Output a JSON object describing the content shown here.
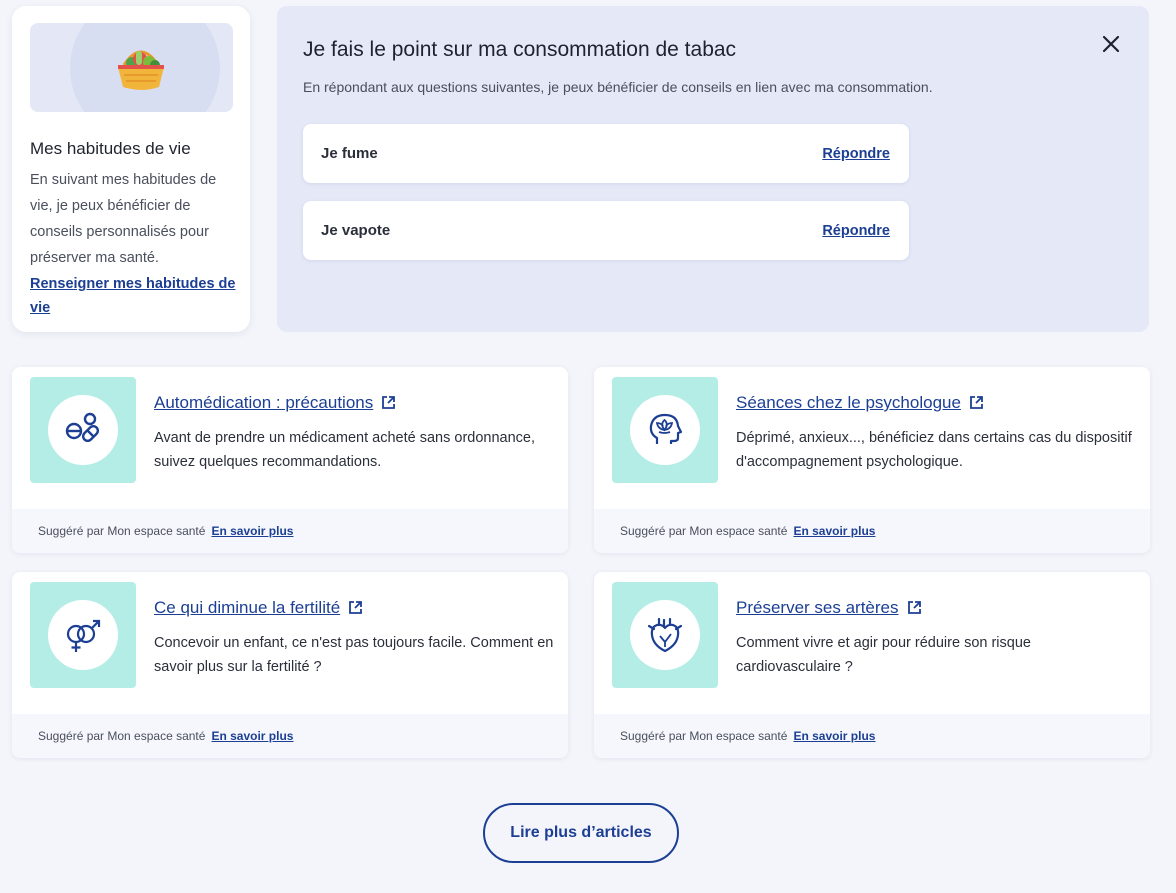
{
  "habits": {
    "illustration_icon": "basket-illustration",
    "title": "Mes habitudes de vie",
    "description": "En suivant mes habitudes de vie, je peux bénéficier de conseils personnalisés pour préserver ma santé.",
    "link": "Renseigner mes habitudes de vie"
  },
  "tabac": {
    "title": "Je fais le point sur ma consommation de tabac",
    "close_icon": "close-icon",
    "subtitle": "En répondant aux questions suivantes, je peux bénéficier de conseils en lien avec ma consommation.",
    "questions": [
      {
        "label": "Je fume",
        "action": "Répondre"
      },
      {
        "label": "Je vapote",
        "action": "Répondre"
      }
    ]
  },
  "articles": [
    {
      "icon": "pills-icon",
      "title": "Automédication : précautions",
      "description": "Avant de prendre un médicament acheté sans ordonnance, suivez quelques recommandations.",
      "footer_text": "Suggéré par Mon espace santé",
      "footer_link": "En savoir plus"
    },
    {
      "icon": "mind-icon",
      "title": "Séances chez le psychologue",
      "description": "Déprimé, anxieux..., bénéficiez dans certains cas du dispositif d'accompagnement psychologique.",
      "footer_text": "Suggéré par Mon espace santé",
      "footer_link": "En savoir plus"
    },
    {
      "icon": "gender-icon",
      "title": "Ce qui diminue la fertilité",
      "description": "Concevoir un enfant, ce n'est pas toujours facile. Comment en savoir plus sur la fertilité ?",
      "footer_text": "Suggéré par Mon espace santé",
      "footer_link": "En savoir plus"
    },
    {
      "icon": "heart-icon",
      "title": "Préserver ses artères",
      "description": "Comment vivre et agir pour réduire son risque cardiovasculaire ?",
      "footer_text": "Suggéré par Mon espace santé",
      "footer_link": "En savoir plus"
    }
  ],
  "more_button": "Lire plus d’articles",
  "colors": {
    "accent": "#1c3f94",
    "background": "#f4f5fb",
    "panel": "#e4e8f7",
    "thumb": "#b4ede6"
  }
}
